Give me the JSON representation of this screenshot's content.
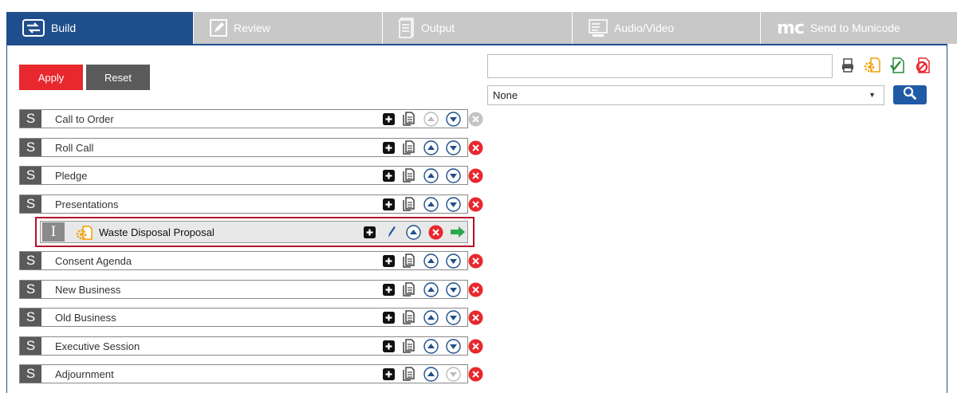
{
  "tabs": [
    {
      "label": "Build",
      "icon": "build-swap-icon",
      "active": true
    },
    {
      "label": "Review",
      "icon": "pencil-icon",
      "active": false
    },
    {
      "label": "Output",
      "icon": "document-stack-icon",
      "active": false
    },
    {
      "label": "Audio/Video",
      "icon": "audio-video-icon",
      "active": false
    },
    {
      "label": "Send to Municode",
      "logo_text": "mc",
      "icon": "municode-logo-icon",
      "active": false
    }
  ],
  "actions": {
    "apply_label": "Apply",
    "reset_label": "Reset"
  },
  "sections": [
    {
      "badge": "S",
      "label": "Call to Order"
    },
    {
      "badge": "S",
      "label": "Roll Call"
    },
    {
      "badge": "S",
      "label": "Pledge"
    },
    {
      "badge": "S",
      "label": "Presentations"
    },
    {
      "badge": "S",
      "label": "Consent Agenda"
    },
    {
      "badge": "S",
      "label": "New Business"
    },
    {
      "badge": "S",
      "label": "Old Business"
    },
    {
      "badge": "S",
      "label": "Executive Session"
    },
    {
      "badge": "S",
      "label": "Adjournment"
    }
  ],
  "item": {
    "badge": "I",
    "label": "Waste Disposal Proposal",
    "icon": "gear-document-icon"
  },
  "search": {
    "value": "",
    "placeholder": ""
  },
  "filter": {
    "selected": "None"
  },
  "colors": {
    "accent": "#1f4e8c",
    "apply": "#e8282e",
    "reset": "#5a5a5a",
    "delete": "#e8282e",
    "highlight": "#b3112e"
  }
}
